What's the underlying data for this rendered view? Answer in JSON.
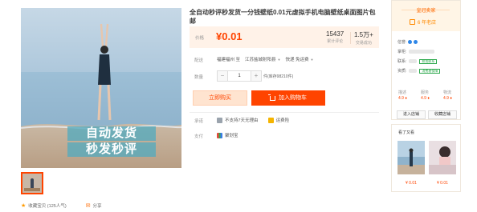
{
  "gallery": {
    "promo_line1": "自动发货",
    "promo_line2": "秒发秒评"
  },
  "title": "全自动秒评秒发货一分钱壁纸0.01元虚拟手机电脑壁纸桌面图片包邮",
  "price_box": {
    "price_label": "价格",
    "price": "¥0.01",
    "sales_count": "15437",
    "sales_label": "累计评论",
    "trade_count": "1.5万+",
    "trade_label": "交易成功"
  },
  "delivery": {
    "label": "配送",
    "from": "福建福州 至",
    "to": "江苏盐城射阳县",
    "shipping": "快递 免运费"
  },
  "quantity": {
    "label": "数量",
    "minus": "−",
    "value": "1",
    "plus": "+",
    "stock": "件(库存98210件)"
  },
  "actions": {
    "buy_now": "立即购买",
    "add_to_cart": "加入购物车"
  },
  "services": {
    "commit_label": "承诺",
    "commit_item1": "不支持7天无理由",
    "commit_item2": "运费险",
    "pay_label": "支付",
    "pay_item1": "聚划宝"
  },
  "share": {
    "collect": "收藏宝贝 (125人气)",
    "share": "分享"
  },
  "shop": {
    "name": "皇冠卖家",
    "years": "6 年老店",
    "grade_label": "信誉:",
    "seller_label": "掌柜:",
    "contact_label": "联系:",
    "contact_badge": "和我联系",
    "quals_label": "资质:",
    "quals_badge": "消费者保障",
    "score_desc": "描述",
    "score_service": "服务",
    "score_logistics": "物流",
    "score_desc_val": "4.9 ♦",
    "score_service_val": "4.9 ♦",
    "score_logistics_val": "4.9 ♦",
    "enter_shop": "进入店铺",
    "favorite_shop": "收藏店铺"
  },
  "watch": {
    "title": "看了又看",
    "price1": "¥ 0.01",
    "price2": "¥ 0.01"
  },
  "colors": {
    "accent": "#ff4400",
    "price_bg": "#fff2e8",
    "shop_head_bg": "#fff5e6"
  }
}
